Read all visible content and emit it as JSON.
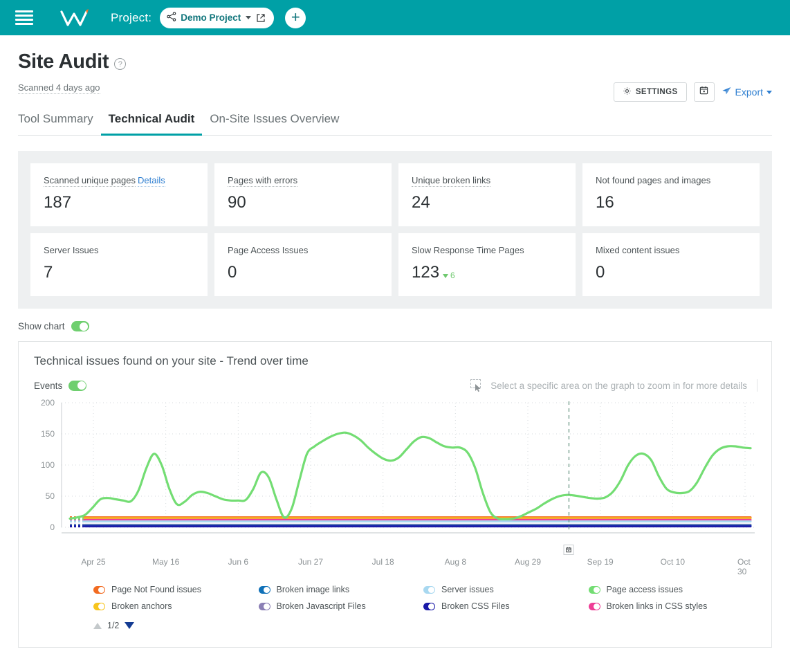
{
  "topbar": {
    "menu_icon": "hamburger-icon",
    "logo": "w-logo",
    "project_label": "Project:",
    "project_name": "Demo Project",
    "project_icon": "share-nodes-icon",
    "open_icon": "external-link-icon",
    "add_label": "+"
  },
  "header": {
    "title": "Site Audit",
    "help_icon": "question-mark-icon",
    "scanned": "Scanned 4 days ago",
    "settings_label": "SETTINGS",
    "settings_icon": "gear-icon",
    "calendar_icon": "calendar-icon",
    "export_label": "Export",
    "export_icon": "send-icon"
  },
  "tabs": [
    {
      "label": "Tool Summary",
      "active": false
    },
    {
      "label": "Technical Audit",
      "active": true
    },
    {
      "label": "On-Site Issues Overview",
      "active": false
    }
  ],
  "cards": [
    {
      "label": "Scanned unique pages",
      "link": "Details",
      "value": "187",
      "dotted": true
    },
    {
      "label": "Pages with errors",
      "link": "",
      "value": "90",
      "dotted": true
    },
    {
      "label": "Unique broken links",
      "link": "",
      "value": "24",
      "dotted": true
    },
    {
      "label": "Not found pages and images",
      "link": "",
      "value": "16",
      "dotted": false
    },
    {
      "label": "Server Issues",
      "link": "",
      "value": "7",
      "dotted": false
    },
    {
      "label": "Page Access Issues",
      "link": "",
      "value": "0",
      "dotted": false
    },
    {
      "label": "Slow Response Time Pages",
      "link": "",
      "value": "123",
      "dotted": false,
      "delta": "6",
      "delta_dir": "down",
      "delta_color": "#6fc96f"
    },
    {
      "label": "Mixed content issues",
      "link": "",
      "value": "0",
      "dotted": false
    }
  ],
  "show_chart": {
    "label": "Show chart",
    "on": true
  },
  "chart_panel": {
    "title": "Technical issues found on your site - Trend over time",
    "events_label": "Events",
    "events_on": true,
    "zoom_hint": "Select a specific area on the graph to zoom in for more details",
    "pager_current": "1/2"
  },
  "chart_data": {
    "type": "line",
    "title": "Technical issues found on your site - Trend over time",
    "xlabel": "",
    "ylabel": "",
    "ylim": [
      0,
      200
    ],
    "yticks": [
      0,
      50,
      100,
      150,
      200
    ],
    "grid": true,
    "legend_position": "bottom",
    "xticks": [
      "Apr 25",
      "May 16",
      "Jun 6",
      "Jun 27",
      "Jul 18",
      "Aug 8",
      "Aug 29",
      "Sep 19",
      "Oct 10",
      "Oct 30"
    ],
    "event_marker": {
      "label": "calendar-icon",
      "x_position": 0.732
    },
    "series": [
      {
        "name": "Page access issues",
        "color": "#73dd73",
        "values": [
          14,
          16,
          20,
          32,
          45,
          47,
          45,
          43,
          42,
          60,
          95,
          118,
          100,
          62,
          37,
          41,
          52,
          57,
          55,
          50,
          45,
          43,
          43,
          44,
          62,
          88,
          80,
          45,
          16,
          30,
          75,
          118,
          130,
          138,
          145,
          150,
          152,
          148,
          140,
          128,
          118,
          110,
          107,
          112,
          125,
          138,
          145,
          143,
          136,
          130,
          128,
          128,
          120,
          95,
          55,
          24,
          14,
          13,
          14,
          18,
          24,
          30,
          38,
          45,
          50,
          52,
          51,
          49,
          47,
          46,
          48,
          57,
          75,
          100,
          115,
          118,
          108,
          82,
          62,
          56,
          55,
          58,
          72,
          95,
          115,
          126,
          130,
          130,
          128,
          127
        ]
      },
      {
        "name": "Page Not Found issues",
        "color": "#f26b21",
        "values_flat": 16
      },
      {
        "name": "Broken anchors",
        "color": "#f7c51e",
        "values_flat": 14.5
      },
      {
        "name": "Broken links in CSS styles",
        "color": "#ee3d96",
        "values_flat": 12
      },
      {
        "name": "Server issues",
        "color": "#a8d8f0",
        "values_flat": 9.5
      },
      {
        "name": "Broken Javascript Files",
        "color": "#8b7fb5",
        "values_flat": 4
      },
      {
        "name": "Broken image links",
        "color": "#1071b8",
        "values_flat": 2.5
      },
      {
        "name": "Broken CSS Files",
        "color": "#1a1aa8",
        "values_flat": 1.5
      }
    ]
  },
  "legend": [
    {
      "label": "Page Not Found issues",
      "color": "#f26b21"
    },
    {
      "label": "Broken image links",
      "color": "#1071b8"
    },
    {
      "label": "Server issues",
      "color": "#a8d8f0"
    },
    {
      "label": "Page access issues",
      "color": "#73dd73"
    },
    {
      "label": "Broken anchors",
      "color": "#f7c51e"
    },
    {
      "label": "Broken Javascript Files",
      "color": "#8b7fb5"
    },
    {
      "label": "Broken CSS Files",
      "color": "#1a1aa8"
    },
    {
      "label": "Broken links in CSS styles",
      "color": "#ee3d96"
    }
  ]
}
